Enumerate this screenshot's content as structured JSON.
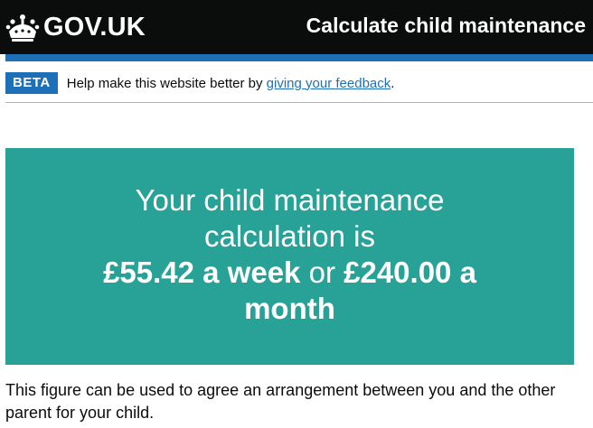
{
  "header": {
    "logo_text": "GOV.UK",
    "service_name": "Calculate child maintenance"
  },
  "beta_banner": {
    "tag": "BETA",
    "text_before": "Help make this website better by ",
    "link_text": "giving your feedback",
    "text_after": "."
  },
  "result_panel": {
    "title": "Your child maintenance calculation is",
    "weekly_amount": "£55.42 a week",
    "connector": " or ",
    "monthly_amount": "£240.00 a month"
  },
  "body": {
    "paragraph": "This figure can be used to agree an arrangement between you and the other parent for your child."
  },
  "colors": {
    "header_bg": "#0b0c0c",
    "brand_blue": "#1d70b8",
    "panel_bg": "#28a197",
    "text": "#0b0c0c"
  }
}
